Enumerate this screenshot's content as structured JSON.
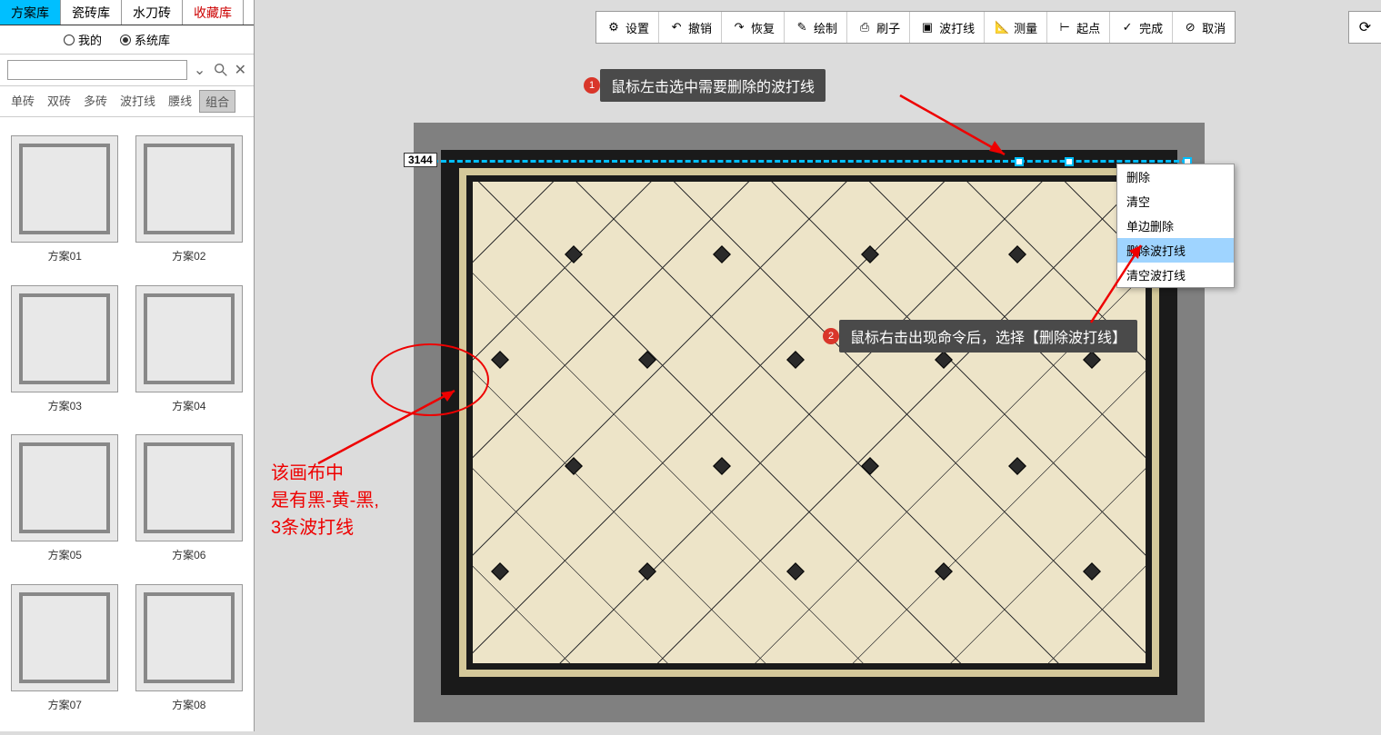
{
  "topTabs": [
    "方案库",
    "瓷砖库",
    "水刀砖",
    "收藏库"
  ],
  "radios": {
    "mine": "我的",
    "system": "系统库"
  },
  "filters": [
    "单砖",
    "双砖",
    "多砖",
    "波打线",
    "腰线",
    "组合"
  ],
  "tiles": [
    "方案01",
    "方案02",
    "方案03",
    "方案04",
    "方案05",
    "方案06",
    "方案07",
    "方案08"
  ],
  "toolbar": [
    "设置",
    "撤销",
    "恢复",
    "绘制",
    "刷子",
    "波打线",
    "测量",
    "起点",
    "完成",
    "取消"
  ],
  "dimension": "3144",
  "contextMenu": [
    "删除",
    "清空",
    "单边删除",
    "删除波打线",
    "清空波打线"
  ],
  "callouts": {
    "c1": "鼠标左击选中需要删除的波打线",
    "c2": "鼠标右击出现命令后，选择【删除波打线】"
  },
  "redNote": [
    "该画布中",
    "是有黑-黄-黑,",
    "3条波打线"
  ]
}
